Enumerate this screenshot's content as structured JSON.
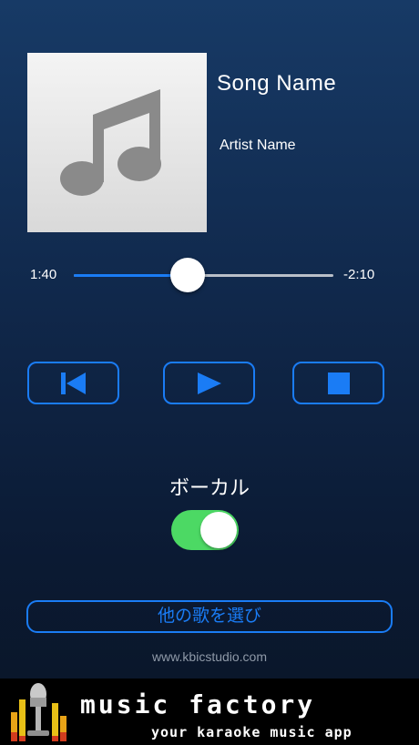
{
  "song": {
    "title": "Song Name",
    "artist": "Artist Name",
    "artwork_icon": "music-note-icon"
  },
  "player": {
    "elapsed": "1:40",
    "remaining": "-2:10",
    "progress": 0.44,
    "controls": [
      "previous-icon",
      "play-icon",
      "stop-icon"
    ]
  },
  "vocal": {
    "label": "ボーカル",
    "enabled": true
  },
  "choose_song_label": "他の歌を選び",
  "website": "www.kbicstudio.com",
  "banner": {
    "brand": "music factory",
    "tagline": "your karaoke music app",
    "logo_icon": "microphone-equalizer-icon"
  },
  "colors": {
    "accent": "#1a7cf5",
    "toggle_on": "#4cd964",
    "background": "#10284b"
  }
}
